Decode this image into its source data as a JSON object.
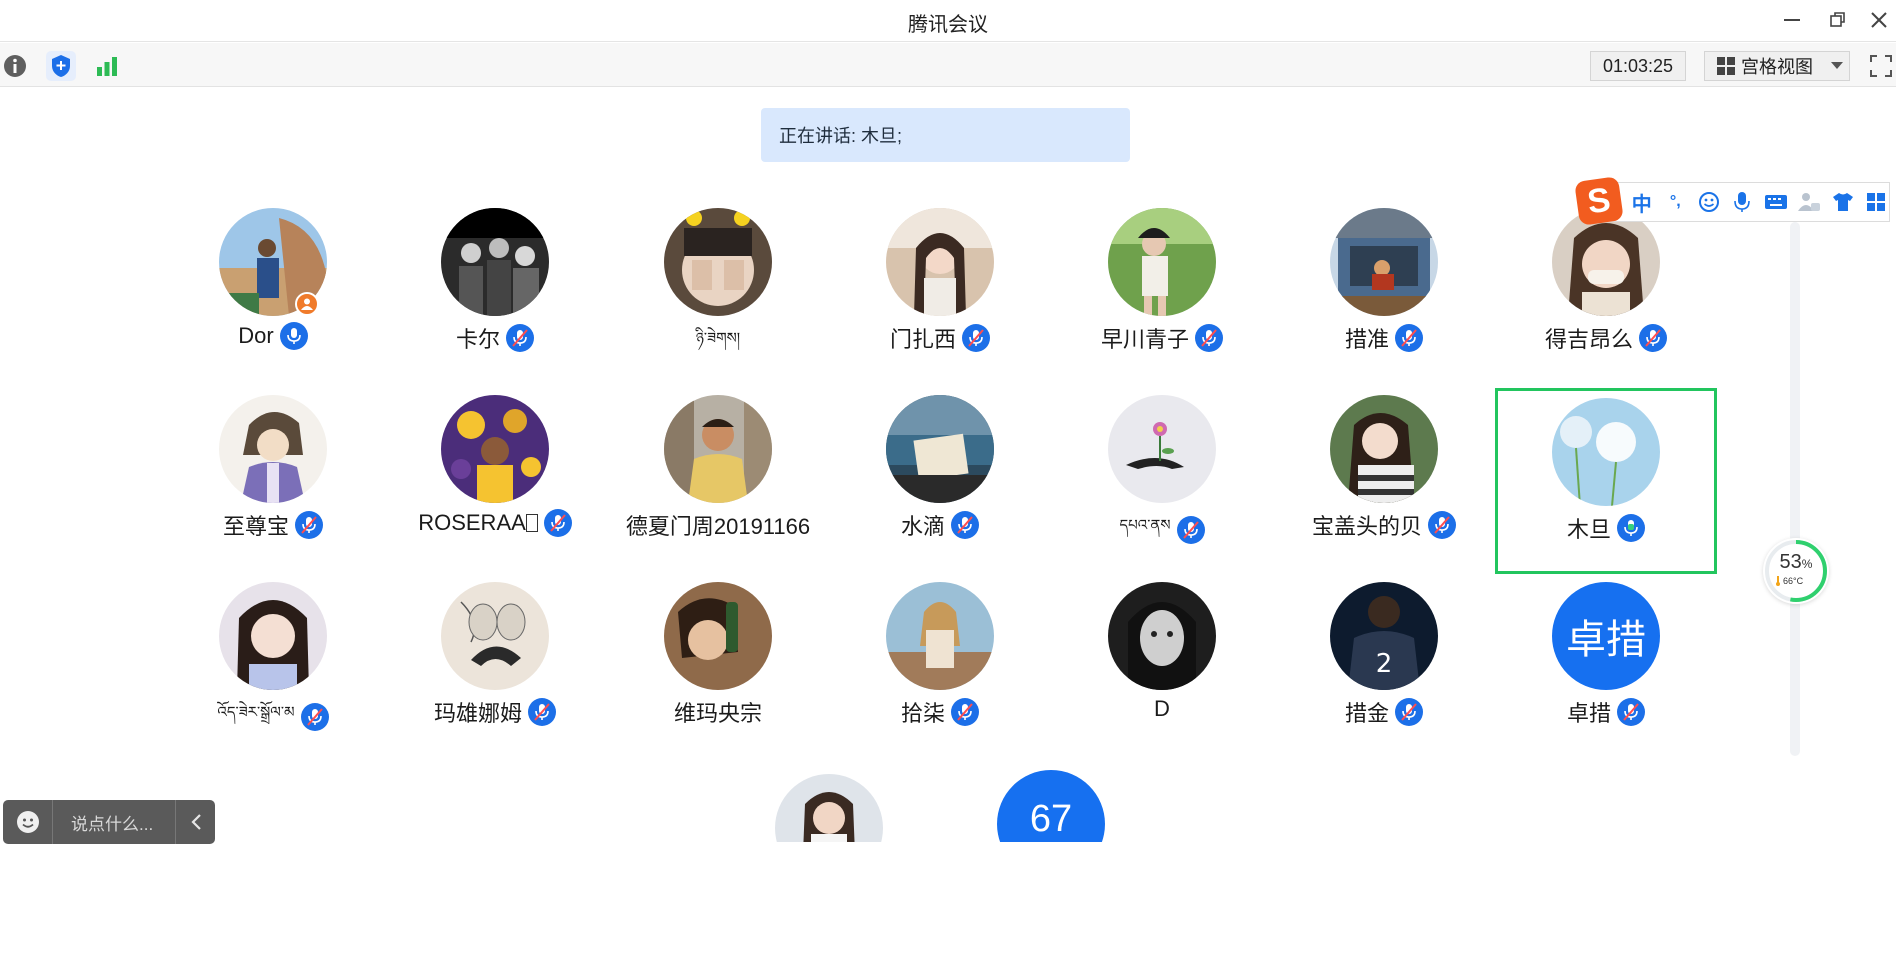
{
  "window": {
    "title": "腾讯会议"
  },
  "toolbar": {
    "timer": "01:03:25",
    "view_label": "宫格视图"
  },
  "speaking": {
    "text": "正在讲话: 木旦;"
  },
  "participants": [
    {
      "name": "Dor",
      "mic": "on"
    },
    {
      "name": "卡尔",
      "mic": "muted"
    },
    {
      "name": "ཉི་ཟེགས།",
      "mic": "none"
    },
    {
      "name": "门扎西",
      "mic": "muted"
    },
    {
      "name": "早川青子",
      "mic": "muted"
    },
    {
      "name": "措准",
      "mic": "muted"
    },
    {
      "name": "得吉昂么",
      "mic": "muted"
    },
    {
      "name": "至尊宝",
      "mic": "muted"
    },
    {
      "name": "ROSERAA",
      "mic": "muted"
    },
    {
      "name": "德夏门周20191166",
      "mic": "none"
    },
    {
      "name": "水滴",
      "mic": "muted"
    },
    {
      "name": "དཔའ་ནས",
      "mic": "muted"
    },
    {
      "name": "宝盖头的贝",
      "mic": "muted"
    },
    {
      "name": "木旦",
      "mic": "speaking"
    },
    {
      "name": "འོད་ཟེར་སྒྲོལ་མ",
      "mic": "muted"
    },
    {
      "name": "玛雄娜姆",
      "mic": "muted"
    },
    {
      "name": "维玛央宗",
      "mic": "none"
    },
    {
      "name": "拾柒",
      "mic": "muted"
    },
    {
      "name": "D",
      "mic": "none"
    },
    {
      "name": "措金",
      "mic": "muted"
    },
    {
      "name": "卓措",
      "mic": "muted",
      "avatar_text": "卓措"
    }
  ],
  "partial_row": {
    "count_avatar_text": "67"
  },
  "ime": {
    "zh_label": "中",
    "punct_label": "°,"
  },
  "gauge": {
    "percent": "53",
    "percent_unit": "%",
    "temp": "66°C"
  },
  "chat": {
    "placeholder": "说点什么..."
  }
}
